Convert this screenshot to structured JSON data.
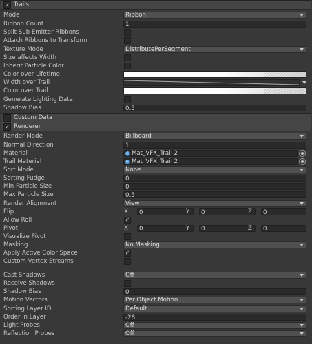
{
  "trails": {
    "header": "Trails",
    "checked": true,
    "mode": {
      "label": "Mode",
      "value": "Ribbon"
    },
    "ribbon_count": {
      "label": "Ribbon Count",
      "value": "1"
    },
    "split_sub_emitter_ribbons": {
      "label": "Split Sub Emitter Ribbons"
    },
    "attach_ribbons": {
      "label": "Attach Ribbons to Transform"
    },
    "texture_mode": {
      "label": "Texture Mode",
      "value": "DistributePerSegment"
    },
    "size_affects_width": {
      "label": "Size affects Width"
    },
    "inherit_particle_color": {
      "label": "Inherit Particle Color"
    },
    "color_over_lifetime": {
      "label": "Color over Lifetime"
    },
    "width_over_trail": {
      "label": "Width over Trail"
    },
    "color_over_trail": {
      "label": "Color over Trail"
    },
    "generate_lighting_data": {
      "label": "Generate Lighting Data"
    },
    "shadow_bias": {
      "label": "Shadow Bias",
      "value": "0.5"
    }
  },
  "custom_data": {
    "header": "Custom Data",
    "checked": false
  },
  "renderer": {
    "header": "Renderer",
    "checked": true,
    "render_mode": {
      "label": "Render Mode",
      "value": "Billboard"
    },
    "normal_direction": {
      "label": "Normal Direction",
      "value": "1"
    },
    "material": {
      "label": "Material",
      "value": "Mat_VFX_Trail 2"
    },
    "trail_material": {
      "label": "Trail Material",
      "value": "Mat_VFX_Trail 2"
    },
    "sort_mode": {
      "label": "Sort Mode",
      "value": "None"
    },
    "sorting_fudge": {
      "label": "Sorting Fudge",
      "value": "0"
    },
    "min_particle_size": {
      "label": "Min Particle Size",
      "value": "0"
    },
    "max_particle_size": {
      "label": "Max Particle Size",
      "value": "0.5"
    },
    "render_alignment": {
      "label": "Render Alignment",
      "value": "View"
    },
    "flip": {
      "label": "Flip",
      "x": "0",
      "y": "0",
      "z": "0"
    },
    "allow_roll": {
      "label": "Allow Roll",
      "checked": true
    },
    "pivot": {
      "label": "Pivot",
      "x": "0",
      "y": "0",
      "z": "0"
    },
    "visualize_pivot": {
      "label": "Visualize Pivot"
    },
    "masking": {
      "label": "Masking",
      "value": "No Masking"
    },
    "apply_active_color_space": {
      "label": "Apply Active Color Space",
      "checked": true
    },
    "custom_vertex_streams": {
      "label": "Custom Vertex Streams"
    },
    "cast_shadows": {
      "label": "Cast Shadows",
      "value": "Off"
    },
    "receive_shadows": {
      "label": "Receive Shadows"
    },
    "shadow_bias": {
      "label": "Shadow Bias",
      "value": "0"
    },
    "motion_vectors": {
      "label": "Motion Vectors",
      "value": "Per Object Motion"
    },
    "sorting_layer_id": {
      "label": "Sorting Layer ID",
      "value": "Default"
    },
    "order_in_layer": {
      "label": "Order in Layer",
      "value": "-28"
    },
    "light_probes": {
      "label": "Light Probes",
      "value": "Off"
    },
    "reflection_probes": {
      "label": "Reflection Probes",
      "value": "Off"
    }
  },
  "axis": {
    "x": "X",
    "y": "Y",
    "z": "Z"
  },
  "glyphs": {
    "check": "✓"
  },
  "icons": {
    "material": "material-sphere-icon",
    "picker": "object-picker-icon",
    "dropdown": "chevron-down-icon"
  }
}
